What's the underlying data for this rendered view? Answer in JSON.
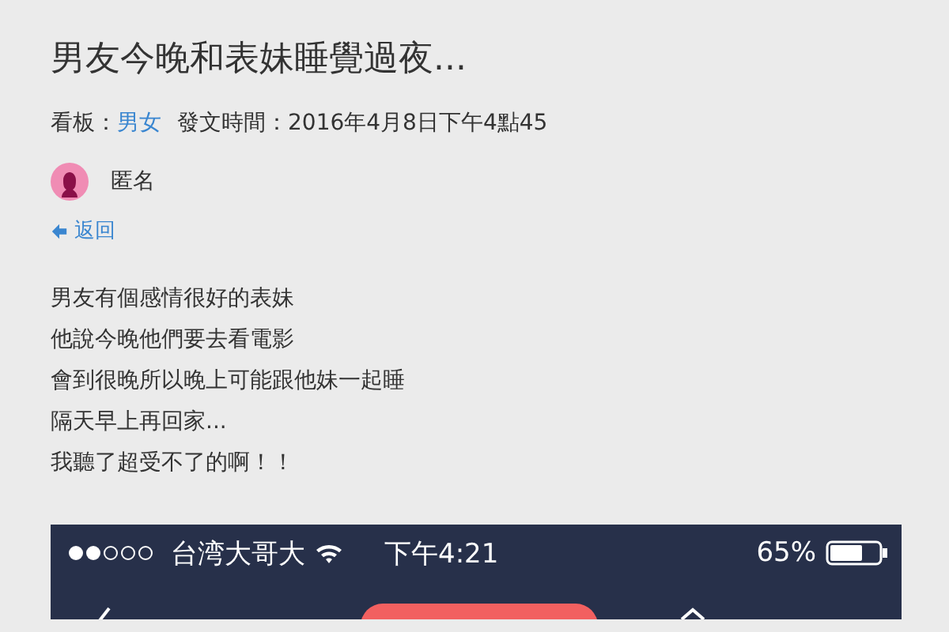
{
  "post": {
    "title": "男友今晚和表妹睡覺過夜...",
    "board_label": "看板：",
    "board": "男女",
    "time": "發文時間：2016年4月8日下午4點45",
    "author": "匿名",
    "back": "返回",
    "lines": [
      "男友有個感情很好的表妹",
      "他說今晚他們要去看電影",
      "會到很晚所以晚上可能跟他妹一起睡",
      "隔天早上再回家...",
      "我聽了超受不了的啊！！"
    ]
  },
  "screenshot": {
    "carrier": "台湾大哥大",
    "time": "下午4:21",
    "battery": "65%"
  }
}
